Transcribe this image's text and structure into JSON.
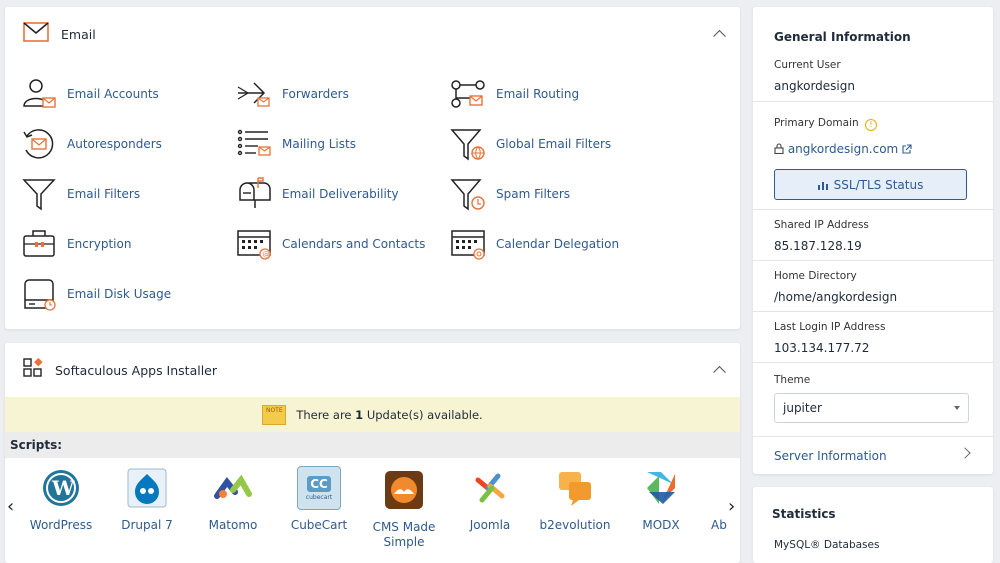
{
  "email": {
    "title": "Email",
    "items": [
      {
        "label": "Email Accounts"
      },
      {
        "label": "Forwarders"
      },
      {
        "label": "Email Routing"
      },
      {
        "label": "Autoresponders"
      },
      {
        "label": "Mailing Lists"
      },
      {
        "label": "Global Email Filters"
      },
      {
        "label": "Email Filters"
      },
      {
        "label": "Email Deliverability"
      },
      {
        "label": "Spam Filters"
      },
      {
        "label": "Encryption"
      },
      {
        "label": "Calendars and Contacts"
      },
      {
        "label": "Calendar Delegation"
      },
      {
        "label": "Email Disk Usage"
      }
    ]
  },
  "softaculous": {
    "title": "Softaculous Apps Installer",
    "notice_prefix": "There are ",
    "notice_count": "1",
    "notice_suffix": " Update(s) available.",
    "note_badge": "NOTE",
    "scripts_label": "Scripts:",
    "apps": [
      {
        "name": "WordPress"
      },
      {
        "name": "Drupal 7"
      },
      {
        "name": "Matomo"
      },
      {
        "name": "CubeCart"
      },
      {
        "name": "CMS Made Simple"
      },
      {
        "name": "Joomla"
      },
      {
        "name": "b2evolution"
      },
      {
        "name": "MODX"
      },
      {
        "name": "Ab"
      }
    ],
    "cubecart_badge": "CC",
    "cubecart_text": "cubecart"
  },
  "general": {
    "title": "General Information",
    "current_user_label": "Current User",
    "current_user": "angkordesign",
    "primary_domain_label": "Primary Domain",
    "primary_domain": "angkordesign.com",
    "ssl_button": "SSL/TLS Status",
    "shared_ip_label": "Shared IP Address",
    "shared_ip": "85.187.128.19",
    "home_dir_label": "Home Directory",
    "home_dir": "/home/angkordesign",
    "last_login_label": "Last Login IP Address",
    "last_login": "103.134.177.72",
    "theme_label": "Theme",
    "theme_value": "jupiter",
    "server_info": "Server Information"
  },
  "statistics": {
    "title": "Statistics",
    "mysql_label": "MySQL® Databases"
  },
  "colors": {
    "link": "#2e5a8f",
    "accent_orange": "#e8733a",
    "notice_bg": "#f7f4d4"
  }
}
